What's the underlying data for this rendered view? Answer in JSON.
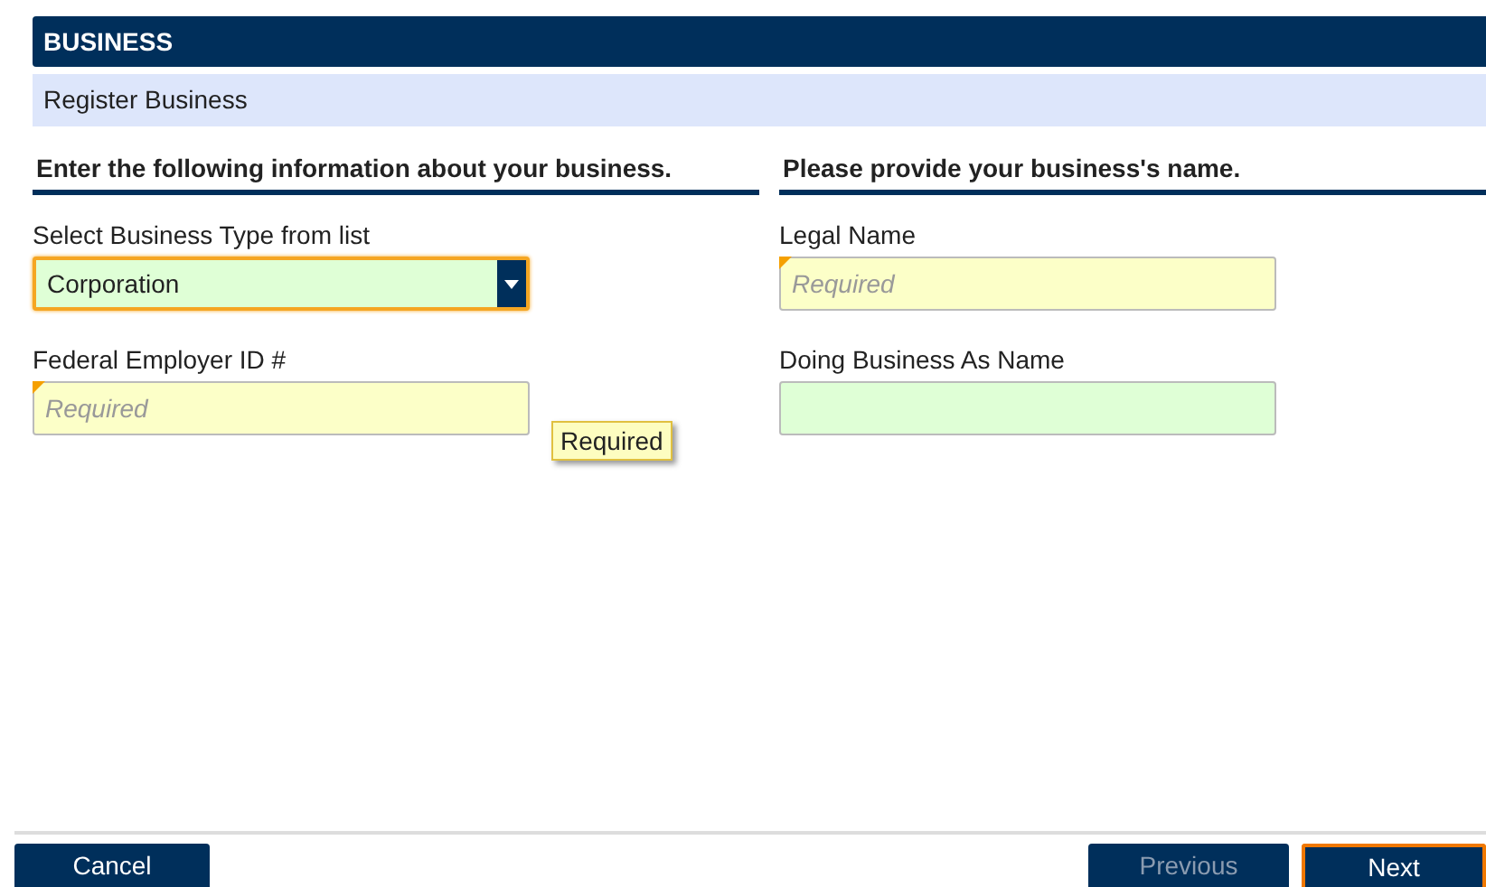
{
  "header": {
    "title": "BUSINESS"
  },
  "subheader": {
    "title": "Register Business"
  },
  "sections": [
    {
      "heading": "Enter the following information about your business.",
      "fields": [
        {
          "kind": "select",
          "label": "Select Business Type from list",
          "value": "Corporation",
          "valid": true,
          "required": false,
          "focused": true
        },
        {
          "kind": "text",
          "label": "Federal Employer ID #",
          "placeholder": "Required",
          "valid": false,
          "required": true,
          "focused": false,
          "tooltip": "Required"
        }
      ]
    },
    {
      "heading": "Please provide your business's name.",
      "fields": [
        {
          "kind": "text",
          "label": "Legal Name",
          "placeholder": "Required",
          "valid": false,
          "required": true,
          "focused": false
        },
        {
          "kind": "text",
          "label": "Doing Business As Name",
          "valid": true,
          "required": false,
          "focused": false
        }
      ]
    }
  ],
  "footer": {
    "buttons": [
      {
        "label": "Cancel",
        "disabled": false,
        "focused": false
      },
      {
        "label": "Previous",
        "disabled": true,
        "focused": false
      },
      {
        "label": "Next",
        "disabled": false,
        "focused": true
      }
    ]
  }
}
